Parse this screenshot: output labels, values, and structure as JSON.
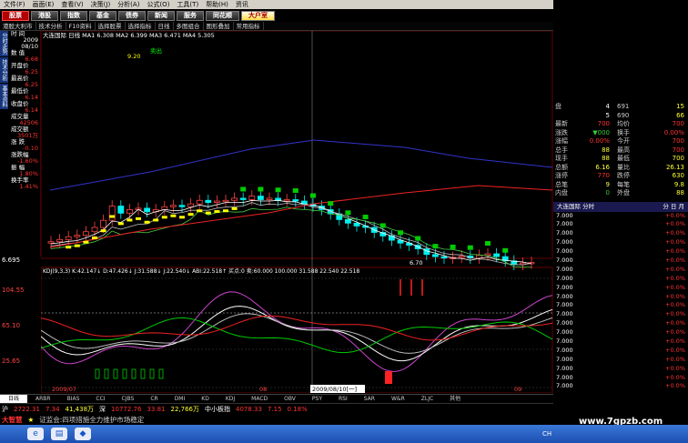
{
  "menu": [
    "文件(F)",
    "画面(E)",
    "查看(V)",
    "决策(J)",
    "分析(A)",
    "公式(O)",
    "工具(T)",
    "帮助(H)",
    "资讯"
  ],
  "nav": [
    {
      "label": "股票",
      "style": "red"
    },
    {
      "label": "港股",
      "style": ""
    },
    {
      "label": "指数",
      "style": ""
    },
    {
      "label": "基金",
      "style": ""
    },
    {
      "label": "债券",
      "style": ""
    },
    {
      "label": "新闻",
      "style": ""
    },
    {
      "label": "服务",
      "style": ""
    },
    {
      "label": "同花顺",
      "style": ""
    },
    {
      "label": "大户室",
      "style": "hi"
    }
  ],
  "subbar": [
    "港股大利市",
    "技术分析",
    "F10资料",
    "选择股票",
    "选择指标",
    "日线",
    "多图组合",
    "图形叠加",
    "常用指标"
  ],
  "left_tabs": [
    "分时走势",
    "技术分析",
    "基本资料"
  ],
  "left_panel": [
    {
      "label": "时 间",
      "value": "2009"
    },
    {
      "label": "",
      "value": "08/10"
    },
    {
      "label": "数 值",
      "value": "6.68"
    },
    {
      "label": "开盘价",
      "value": "6.25"
    },
    {
      "label": "最高价",
      "value": "6.25"
    },
    {
      "label": "最低价",
      "value": "6.14"
    },
    {
      "label": "收盘价",
      "value": "6.14"
    },
    {
      "label": "成交量",
      "value": "42506"
    },
    {
      "label": "成交额",
      "value": "3501万"
    },
    {
      "label": "涨 跌",
      "value": "-0.10"
    },
    {
      "label": "涨跌幅",
      "value": "-1.60%"
    },
    {
      "label": "振 幅",
      "value": "1.80%"
    },
    {
      "label": "换手率",
      "value": "1.41%"
    }
  ],
  "chart_header": "大连国际 日线  MA1 6.308  MA2 6.399  MA3 6.471  MA4 5.305",
  "chart_labels": {
    "sell": "卖出",
    "high": "9.20",
    "low": "6.70",
    "price_left": "6.695",
    "buy": "买入"
  },
  "indicator_header": "KDJ(9,3,3)  K:42.147↓  D:47.426↓  J:31.588↓  J:22.540↓  ABI:22.518↑  买点:0  卖:60.000  100.000  31.588  22.540  22.518",
  "indicator_axis": [
    "104.55",
    "65.10",
    "25.65",
    "-13.80"
  ],
  "date_label": "2009/08/10[一]",
  "date_marks": [
    "2009/07",
    "08",
    "09"
  ],
  "tabs": [
    "日线",
    "ARBR",
    "BIAS",
    "CCI",
    "CJBS",
    "CR",
    "DMI",
    "KD",
    "KDJ",
    "MACD",
    "OBV",
    "PSY",
    "RSI",
    "SAR",
    "W&R",
    "ZLJC",
    "其他"
  ],
  "ticker": {
    "label1": "沪",
    "v1": "2722.31",
    "d1": "7.34",
    "amt1": "41,438万",
    "label2": "深",
    "v2": "10772.76",
    "d2": "33.81",
    "amt2": "22,766万",
    "label3": "中小板指",
    "v3": "4078.33",
    "d3": "7.15",
    "pct": "0.18%"
  },
  "news": "证监会:四项措施全力维护市场稳定",
  "news_tag": "大智慧",
  "quote": {
    "top": [
      [
        "盘",
        "4",
        "691",
        "15"
      ],
      [
        "",
        "5",
        "690",
        "66"
      ]
    ],
    "rows": [
      [
        "最新",
        "700",
        "均价",
        "700"
      ],
      [
        "涨跌",
        "▼000",
        "换手",
        "0.00%"
      ],
      [
        "涨幅",
        "0.00%",
        "今开",
        "700"
      ],
      [
        "总手",
        "88",
        "最高",
        "700"
      ],
      [
        "现手",
        "88",
        "最低",
        "700"
      ],
      [
        "总额",
        "6.16",
        "量比",
        "26.13"
      ],
      [
        "涨停",
        "770",
        "跌停",
        "630"
      ],
      [
        "总笔",
        "9",
        "每笔",
        "9.8"
      ],
      [
        "内盘",
        "0",
        "外盘",
        "88"
      ]
    ],
    "title_left": "大连国际 分时",
    "title_right": "分 日 月",
    "trades": [
      "7.000",
      "7.000",
      "7.000",
      "7.000",
      "7.000",
      "7.000",
      "7.000",
      "7.000",
      "7.000",
      "7.000",
      "7.000",
      "7.000",
      "7.000",
      "7.000",
      "7.000",
      "7.000",
      "7.000",
      "7.000",
      "7.000",
      "7.000"
    ],
    "trades_right": "+0.0%"
  },
  "watermark": "www.7gpzb.com",
  "systray": "CH"
}
